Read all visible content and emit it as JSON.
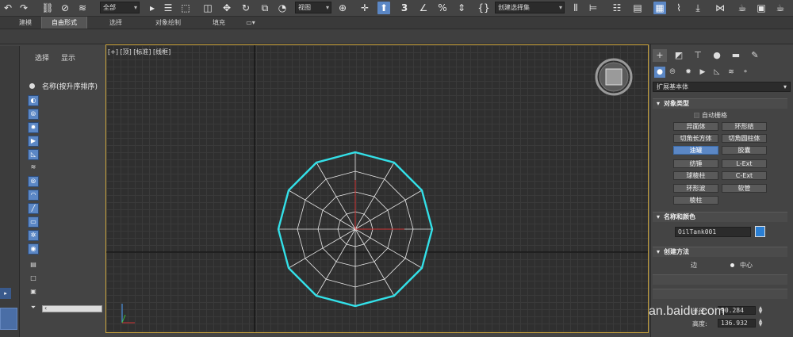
{
  "toolbar": {
    "filter_label": "全部",
    "view_label": "视图",
    "selection_set_label": "创建选择集",
    "snap_label": "3",
    "undo_icon": "undo-icon",
    "redo_icon": "redo-icon"
  },
  "ribbon": {
    "tabs": [
      "建模",
      "自由形式",
      "选择",
      "对象绘制",
      "填充"
    ]
  },
  "explorer": {
    "menu_select": "选择",
    "menu_display": "显示",
    "name_header": "名称(按升序排序)"
  },
  "viewport": {
    "label": "[+] [顶] [标准] [线框]"
  },
  "command_panel": {
    "category_label": "扩展基本体",
    "rollouts": {
      "object_type": "对象类型",
      "name_color": "名称和颜色",
      "creation_method": "创建方法"
    },
    "autogrid_label": "自动栅格",
    "buttons": [
      [
        "异面体",
        "环形结"
      ],
      [
        "切角长方体",
        "切角圆柱体"
      ],
      [
        "油罐",
        "胶囊"
      ],
      [
        "纺锤",
        "L-Ext"
      ],
      [
        "球棱柱",
        "C-Ext"
      ],
      [
        "环形波",
        "软管"
      ],
      [
        "棱柱",
        ""
      ]
    ],
    "active_button": "油罐",
    "object_name": "OilTank001",
    "object_color": "#2a7fd4",
    "creation_options": [
      "边",
      "中心"
    ],
    "selected_creation": "中心",
    "params": {
      "radius_label": "半径:",
      "radius_value": "90.284",
      "height_label": "高度:",
      "height_value": "136.932"
    }
  },
  "watermark": "an.baidu.com"
}
